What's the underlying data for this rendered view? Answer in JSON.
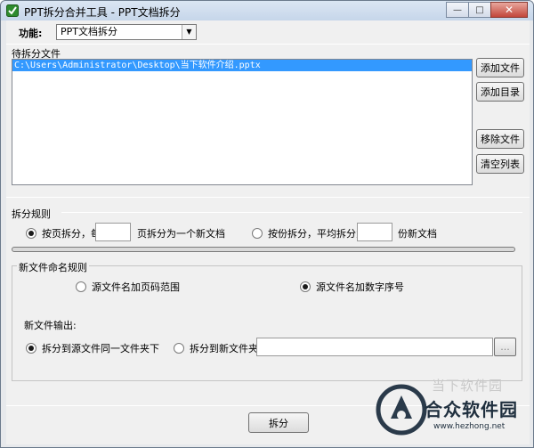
{
  "window": {
    "title": "PPT拆分合并工具 - PPT文档拆分",
    "minimize_glyph": "—",
    "maximize_glyph": "□",
    "close_glyph": "✕"
  },
  "function": {
    "label": "功能:",
    "selected": "PPT文档拆分"
  },
  "files": {
    "group_label": "待拆分文件",
    "items": [
      "C:\\Users\\Administrator\\Desktop\\当下软件介绍.pptx"
    ],
    "add_file": "添加文件",
    "add_dir": "添加目录",
    "remove_file": "移除文件",
    "clear_list": "清空列表"
  },
  "split_rule": {
    "group_label": "拆分规则",
    "by_page_prefix": "按页拆分，每",
    "by_page_suffix": "页拆分为一个新文档",
    "by_copies_prefix": "按份拆分，平均拆分为",
    "by_copies_suffix": "份新文档",
    "by_page_selected": true,
    "by_copies_selected": false
  },
  "naming": {
    "group_label": "新文件命名规则",
    "opt_page_range": "源文件名加页码范围",
    "opt_number_seq": "源文件名加数字序号",
    "page_range_selected": false,
    "number_seq_selected": true,
    "output_label": "新文件输出:",
    "opt_same_folder": "拆分到源文件同一文件夹下",
    "opt_new_folder": "拆分到新文件夹:",
    "same_folder_selected": true,
    "new_folder_selected": false,
    "browse": "..."
  },
  "actions": {
    "split": "拆分"
  },
  "watermark": {
    "line1": "当下软件园",
    "line2": "合众软件园",
    "line3": "www.hezhong.net"
  }
}
